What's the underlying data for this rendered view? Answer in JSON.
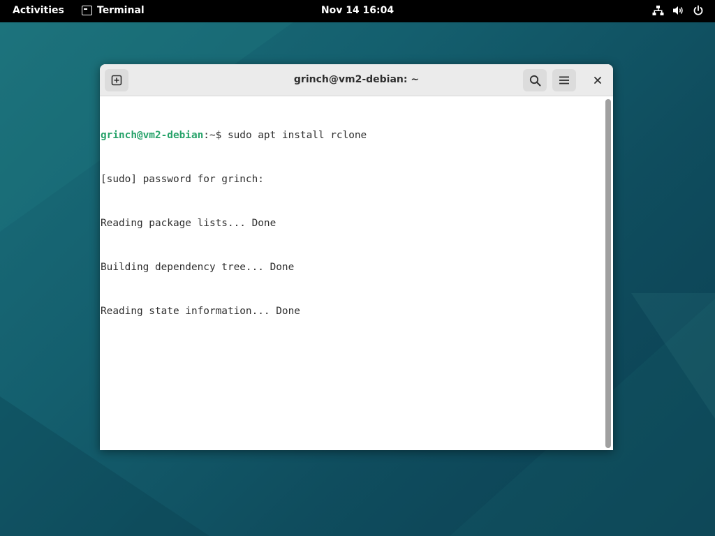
{
  "topbar": {
    "activities": "Activities",
    "app_name": "Terminal",
    "clock": "Nov 14  16:04",
    "tray_icons": [
      "network-icon",
      "volume-icon",
      "power-icon"
    ]
  },
  "window": {
    "title": "grinch@vm2-debian: ~",
    "header_buttons": [
      "new-tab-icon",
      "search-icon",
      "hamburger-menu-icon",
      "close-icon"
    ]
  },
  "terminal": {
    "prompt_user_host": "grinch@vm2-debian",
    "prompt_path": ":~",
    "prompt_symbol": "$ ",
    "command": "sudo apt install rclone",
    "output": [
      "[sudo] password for grinch:",
      "Reading package lists... Done",
      "Building dependency tree... Done",
      "Reading state information... Done"
    ]
  },
  "colors": {
    "prompt_green": "#26a269",
    "topbar_bg": "#000000",
    "headerbar_bg": "#ebebeb",
    "wallpaper": "#145f6e"
  }
}
